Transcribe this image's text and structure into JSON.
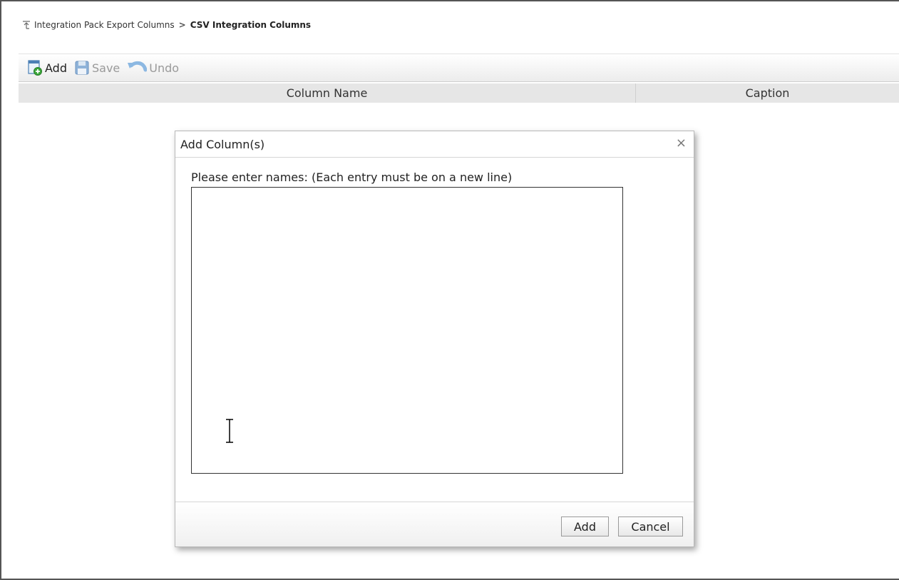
{
  "breadcrumb": {
    "parent": "Integration Pack Export Columns",
    "separator": ">",
    "current": "CSV Integration Columns",
    "icon": "up-level-icon"
  },
  "toolbar": {
    "add_label": "Add",
    "save_label": "Save",
    "undo_label": "Undo",
    "add_icon": "add-document-icon",
    "save_icon": "floppy-disk-icon",
    "undo_icon": "undo-arrow-icon"
  },
  "grid": {
    "columns": [
      "Column Name",
      "Caption"
    ]
  },
  "dialog": {
    "title": "Add Column(s)",
    "close_glyph": "×",
    "prompt": "Please enter names: (Each entry must be on a new line)",
    "textarea_value": "",
    "add_button": "Add",
    "cancel_button": "Cancel"
  },
  "colors": {
    "toolbar_bg": "#ececec",
    "header_bg": "#e6e6e6",
    "add_icon_green": "#3aa63a",
    "save_icon_blue": "#5b8fc7",
    "undo_icon_blue": "#6fa6d9"
  }
}
